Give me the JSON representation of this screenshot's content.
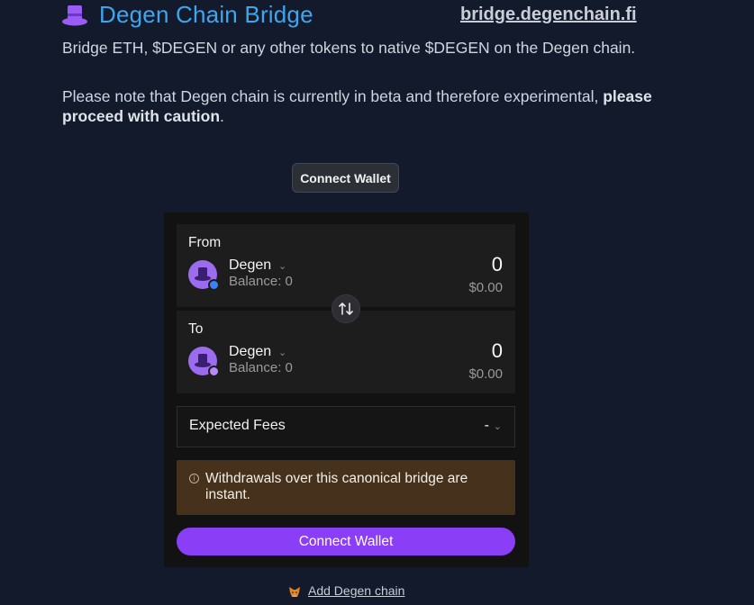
{
  "header": {
    "title": "Degen Chain Bridge",
    "site_link": "bridge.degenchain.fi",
    "icon": "top-hat-icon"
  },
  "intro": {
    "text": "Bridge ETH, $DEGEN or any other tokens to native $DEGEN on the Degen chain.",
    "note_prefix": "Please note that Degen chain is currently in beta and therefore experimental, ",
    "note_bold": "please proceed with caution",
    "note_suffix": "."
  },
  "top_connect": {
    "label": "Connect Wallet"
  },
  "bridge": {
    "from": {
      "label": "From",
      "token": "Degen",
      "balance": "Balance: 0",
      "amount": "0",
      "usd": "$0.00",
      "network_badge": "ethereum-badge-icon"
    },
    "to": {
      "label": "To",
      "token": "Degen",
      "balance": "Balance: 0",
      "amount": "0",
      "usd": "$0.00",
      "network_badge": "degen-badge-icon"
    },
    "swap_icon": "swap-arrows-icon",
    "fees": {
      "label": "Expected Fees",
      "value": "-"
    },
    "notice": {
      "text": "Withdrawals over this canonical bridge are instant.",
      "icon": "info-icon"
    },
    "connect_label": "Connect Wallet"
  },
  "footer": {
    "add_chain": "Add Degen chain",
    "icon": "metamask-fox-icon"
  },
  "colors": {
    "background": "#121a2b",
    "title": "#3fa6ee",
    "accent": "#8a3ef6",
    "token": "#9b6cf0",
    "notice_bg": "#45311c"
  }
}
